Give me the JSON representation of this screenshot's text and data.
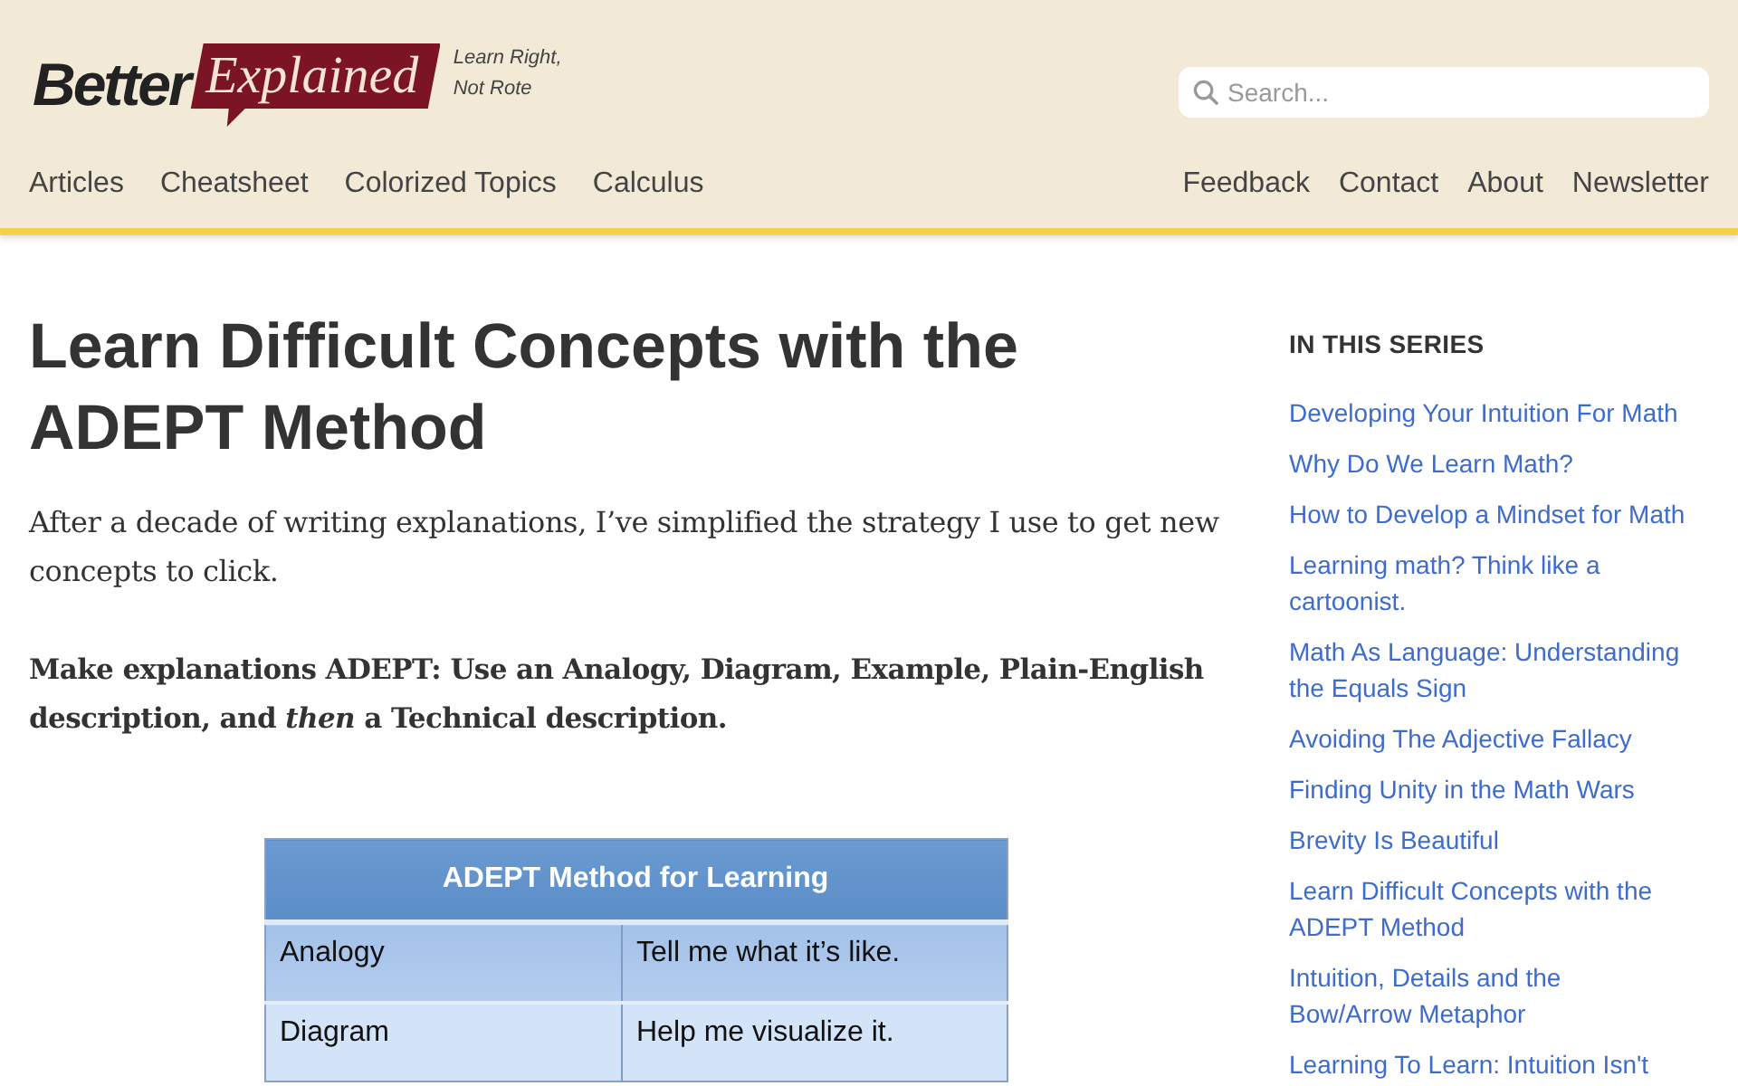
{
  "header": {
    "logo": {
      "dark_word": "Better",
      "badge_word": "Explained"
    },
    "tagline": "Learn Right, Not Rote",
    "search": {
      "placeholder": "Search..."
    },
    "nav_left": [
      "Articles",
      "Cheatsheet",
      "Colorized Topics",
      "Calculus"
    ],
    "nav_right": [
      "Feedback",
      "Contact",
      "About",
      "Newsletter"
    ]
  },
  "article": {
    "title": "Learn Difficult Concepts with the ADEPT Method",
    "intro": "After a decade of writing explanations, I’ve simplified the strategy I use to get new concepts to click.",
    "lead": "Make explanations ADEPT: Use an Analogy, Diagram, Example, Plain-English description, and *then* a Technical description.",
    "figure_table": {
      "title": "ADEPT Method for Learning",
      "rows": [
        [
          "Analogy",
          "Tell me what it’s like."
        ],
        [
          "Diagram",
          "Help me visualize it."
        ]
      ]
    }
  },
  "sidebar": {
    "heading": "IN THIS SERIES",
    "links": [
      "Developing Your Intuition For Math",
      "Why Do We Learn Math?",
      "How to Develop a Mindset for Math",
      "Learning math? Think like a cartoonist.",
      "Math As Language: Understanding the Equals Sign",
      "Avoiding The Adjective Fallacy",
      "Finding Unity in the Math Wars",
      "Brevity Is Beautiful",
      "Learn Difficult Concepts with the ADEPT Method",
      "Intuition, Details and the Bow/Arrow Metaphor",
      "Learning To Learn: Intuition Isn't"
    ]
  }
}
